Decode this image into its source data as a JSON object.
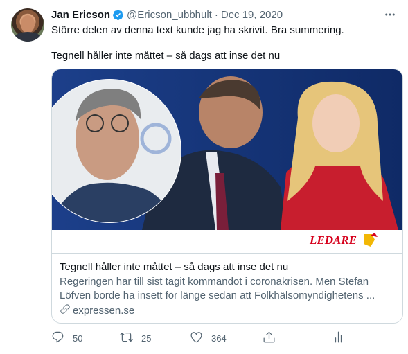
{
  "tweet": {
    "author_name": "Jan Ericson",
    "handle": "@Ericson_ubbhult",
    "separator": "·",
    "date": "Dec 19, 2020",
    "text_line1": "Större delen av denna text kunde jag ha skrivit. Bra summering.",
    "text_line2": "Tegnell håller inte måttet – så dags att inse det nu"
  },
  "card": {
    "badge": "LEDARE",
    "title": "Tegnell håller inte måttet – så dags att inse det nu",
    "description": "Regeringen har till sist tagit kommandot i coronakrisen. Men Stefan Löfven borde ha insett för länge sedan att Folkhälsomyndighetens ...",
    "domain": "expressen.se"
  },
  "actions": {
    "replies": "50",
    "retweets": "25",
    "likes": "364"
  },
  "icons": {
    "verified": "verified-badge-icon",
    "more": "more-icon",
    "reply": "reply-icon",
    "retweet": "retweet-icon",
    "like": "like-icon",
    "share": "share-icon",
    "analytics": "analytics-icon",
    "link": "link-icon"
  },
  "colors": {
    "text": "#0f1419",
    "muted": "#536471",
    "verified": "#1d9bf0",
    "border": "#cfd9de",
    "ledare_red": "#d6001c"
  }
}
